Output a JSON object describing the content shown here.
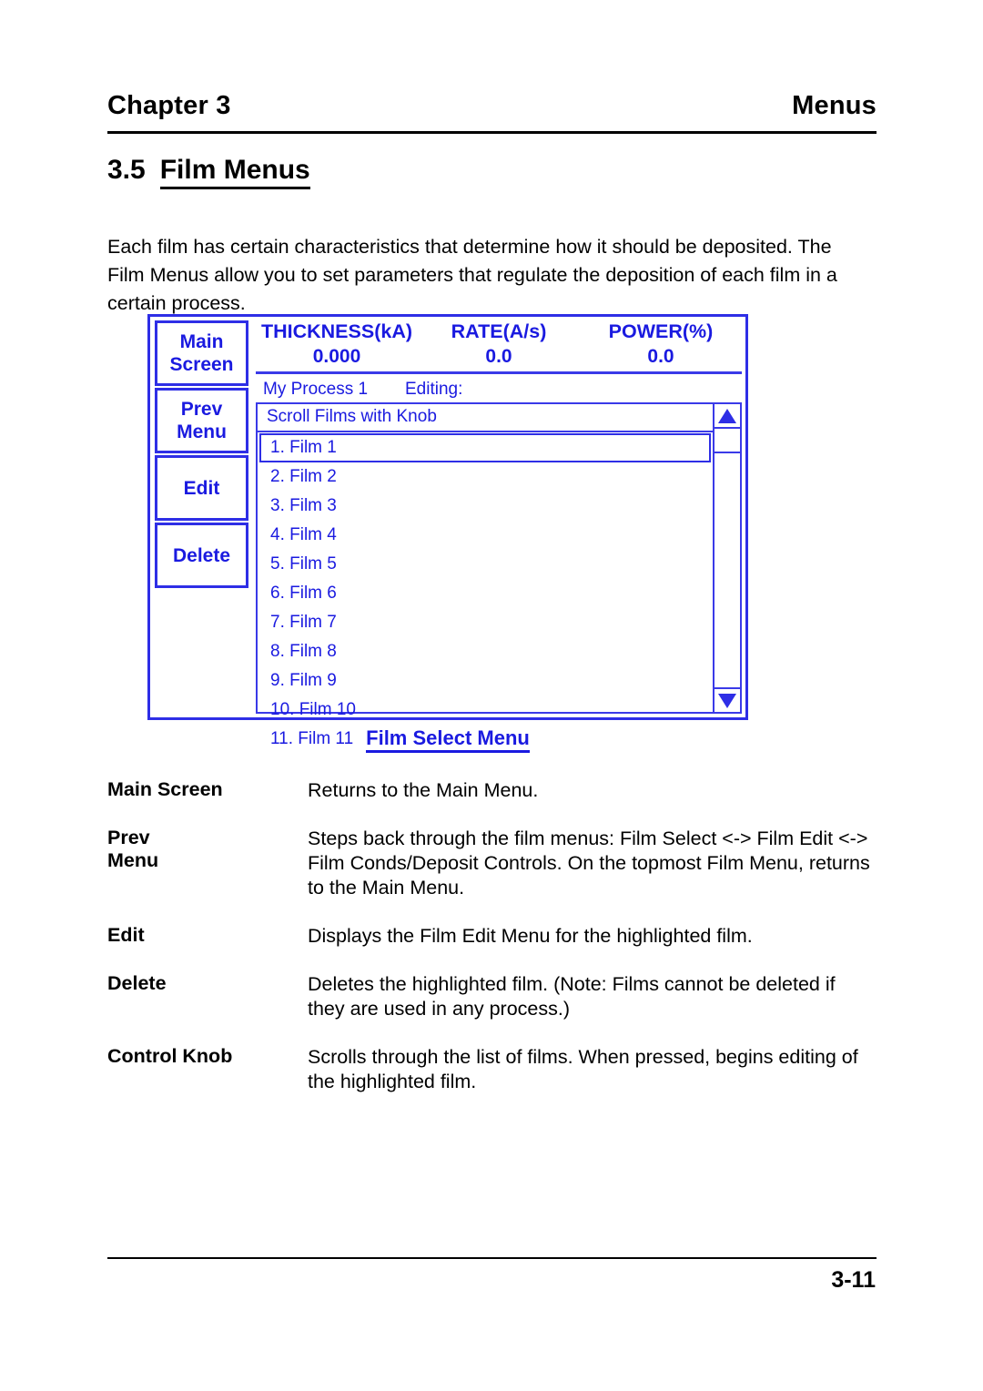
{
  "header": {
    "chapter": "Chapter 3",
    "running_title": "Menus"
  },
  "section": {
    "number": "3.5",
    "title": "Film Menus"
  },
  "intro": "Each film has certain characteristics that determine how it should be deposited.  The Film Menus allow you to set parameters that regulate the deposition of each film in a certain process.",
  "figure": {
    "caption": "Film Select Menu",
    "softkeys": [
      {
        "line1": "Main",
        "line2": "Screen"
      },
      {
        "line1": "Prev",
        "line2": "Menu"
      },
      {
        "line1": "Edit",
        "line2": ""
      },
      {
        "line1": "Delete",
        "line2": ""
      }
    ],
    "readouts": {
      "labels": [
        "THICKNESS(kA)",
        "RATE(A/s)",
        "POWER(%)"
      ],
      "values": [
        "0.000",
        "0.0",
        "0.0"
      ]
    },
    "status": {
      "process": "My Process 1",
      "editing": "Editing:"
    },
    "list": {
      "title": "Scroll Films with Knob",
      "items": [
        "1. Film 1",
        "2. Film 2",
        "3. Film 3",
        "4. Film 4",
        "5. Film 5",
        "6. Film 6",
        "7. Film 7",
        "8. Film 8",
        "9. Film 9",
        "10. Film 10",
        "11. Film 11"
      ],
      "selected_index": 0
    },
    "scrollbar": {
      "up_icon": "triangle-up-icon",
      "down_icon": "triangle-down-icon"
    },
    "colors": {
      "screen_blue": "#1a1ae0",
      "border_blue": "#2e2ee6"
    }
  },
  "definitions": [
    {
      "term_line1": "Main Screen",
      "term_line2": "",
      "description": "Returns to the Main Menu."
    },
    {
      "term_line1": "Prev",
      "term_line2": "Menu",
      "description": "Steps back through the film menus: Film Select <-> Film Edit <-> Film Conds/Deposit Controls.  On the topmost Film Menu, returns to the Main Menu."
    },
    {
      "term_line1": "Edit",
      "term_line2": "",
      "description": "Displays the Film Edit Menu for the highlighted film."
    },
    {
      "term_line1": "Delete",
      "term_line2": "",
      "description": "Deletes the highlighted film.  (Note: Films cannot be deleted if they are used in any process.)"
    },
    {
      "term_line1": "Control Knob",
      "term_line2": "",
      "description": "Scrolls through the list of films.  When pressed, begins editing of the highlighted film."
    }
  ],
  "footer": {
    "page_number": "3-11"
  }
}
